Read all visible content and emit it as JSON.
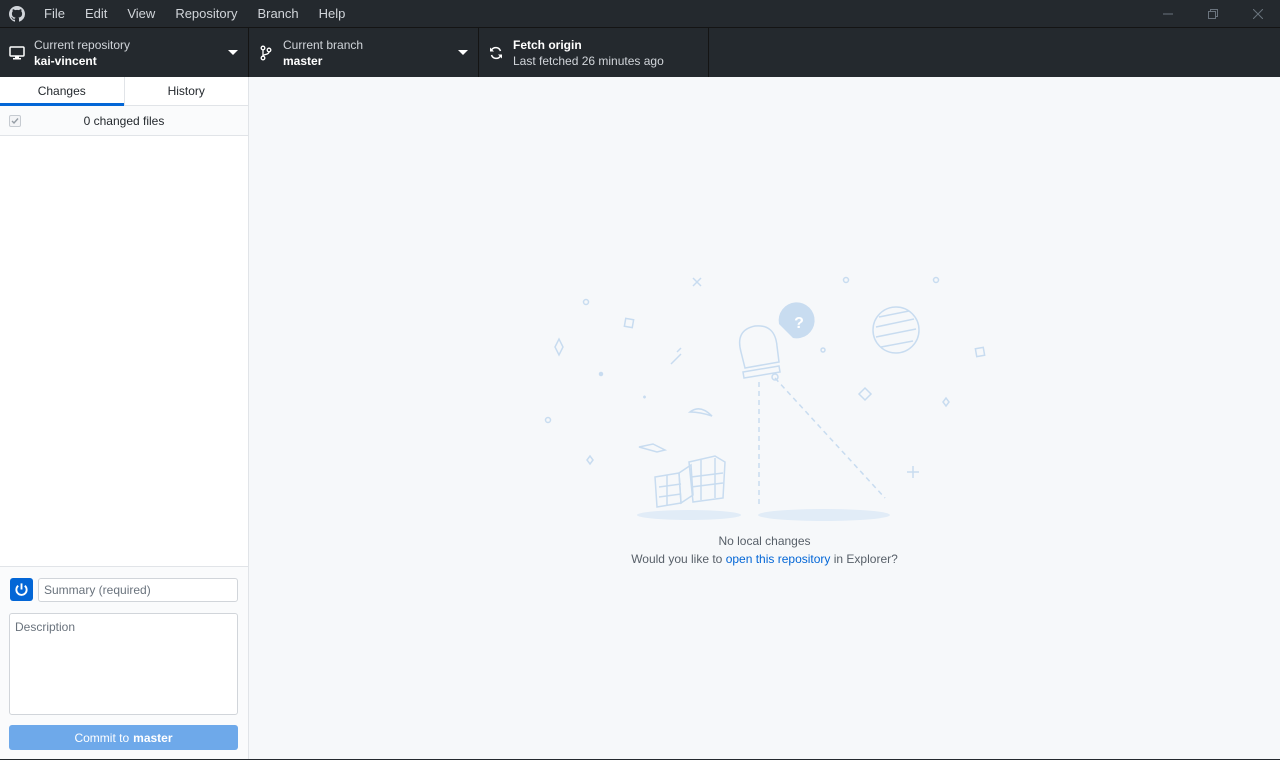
{
  "menu": [
    "File",
    "Edit",
    "View",
    "Repository",
    "Branch",
    "Help"
  ],
  "toolbar": {
    "repo_label": "Current repository",
    "repo_value": "kai-vincent",
    "branch_label": "Current branch",
    "branch_value": "master",
    "fetch_title": "Fetch origin",
    "fetch_sub": "Last fetched 26 minutes ago"
  },
  "sidebar": {
    "tabs": [
      "Changes",
      "History"
    ],
    "active_tab": "Changes",
    "changed_files": "0 changed files"
  },
  "commit": {
    "summary_placeholder": "Summary (required)",
    "description_placeholder": "Description",
    "button_prefix": "Commit to",
    "button_branch": "master"
  },
  "main": {
    "title": "No local changes",
    "message_before": "Would you like to ",
    "link_text": "open this repository",
    "message_after": " in Explorer?"
  },
  "icons": {
    "logo": "github-icon",
    "repo": "desktop-icon",
    "branch": "git-branch-icon",
    "fetch": "sync-icon"
  },
  "colors": {
    "titlebar": "#24292e",
    "accent": "#0366d6",
    "commit_button": "#6ea9ea",
    "illustration": "#c8dcf0"
  }
}
